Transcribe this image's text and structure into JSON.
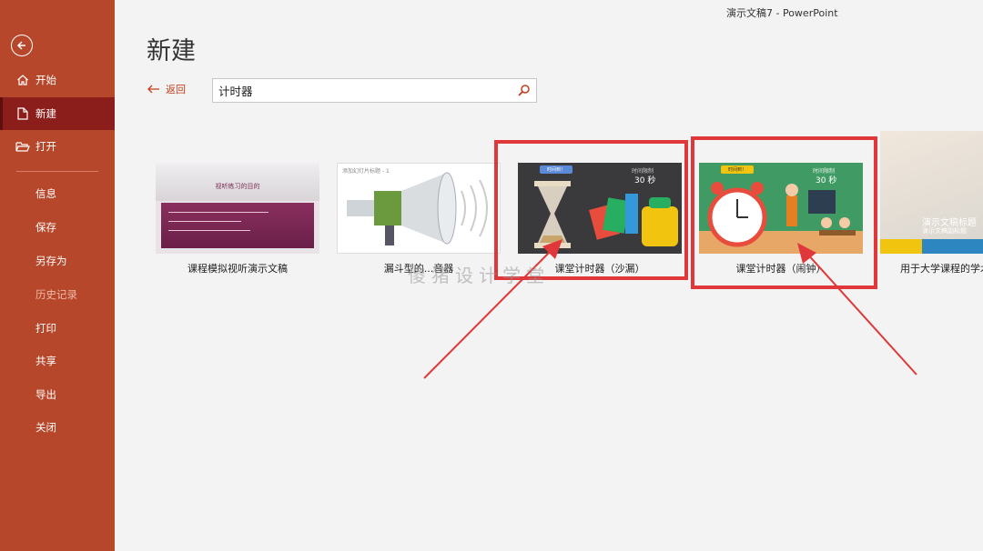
{
  "window": {
    "title": "演示文稿7  -  PowerPoint"
  },
  "sidebar": {
    "items": [
      {
        "label": "开始",
        "icon": "home-icon"
      },
      {
        "label": "新建",
        "icon": "new-document-icon",
        "active": true
      },
      {
        "label": "打开",
        "icon": "folder-open-icon"
      },
      {
        "label": "信息"
      },
      {
        "label": "保存"
      },
      {
        "label": "另存为"
      },
      {
        "label": "历史记录",
        "muted": true
      },
      {
        "label": "打印"
      },
      {
        "label": "共享"
      },
      {
        "label": "导出"
      },
      {
        "label": "关闭"
      }
    ]
  },
  "main": {
    "title": "新建",
    "back_label": "返回",
    "search": {
      "value": "计时器"
    }
  },
  "templates": [
    {
      "caption": "课程模拟视听演示文稿",
      "slide_title": "视听练习的目的"
    },
    {
      "caption": "漏斗型的...音器",
      "slide_title": "添加幻灯片标题 - 1"
    },
    {
      "caption": "课堂计时器（沙漏）",
      "badge": "时间到！",
      "timer_label": "时间限制",
      "timer_value": "30 秒"
    },
    {
      "caption": "课堂计时器（闹钟）",
      "badge": "时间到！",
      "timer_label": "时间限制",
      "timer_value": "30 秒"
    },
    {
      "caption": "用于大学课程的学术",
      "slide_title": "演示文稿标题",
      "slide_subtitle": "演示文稿副标题"
    }
  ],
  "watermark": "傻猪设计学堂",
  "colors": {
    "sidebar": "#b7472a",
    "active": "#8b1e1a",
    "highlight": "#e0383a"
  }
}
